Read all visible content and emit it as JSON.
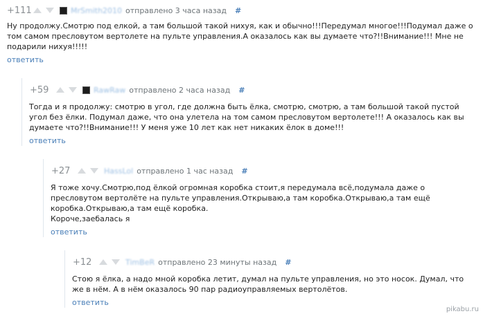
{
  "comments": [
    {
      "rating": "+111",
      "author": "MrSmith2010",
      "sent": "отправлено 3 часа назад",
      "hash": "#",
      "text": "Ну продолжу.Смотрю под елкой, а там большой такой нихуя, как и обычно!!!Передумал многое!!!Подумал даже о том самом пресловутом вертолете на пульте управления.А оказалось как вы думаете что?!!Внимание!!! Мне не подарили нихуя!!!!!",
      "reply": "ответить"
    },
    {
      "rating": "+59",
      "author": "RawRaw",
      "sent": "отправлено 2 часа назад",
      "hash": "#",
      "text": "Тогда и я продолжу: смотрю в угол, где должна быть ёлка, смотрю, смотрю, а там большой такой пустой угол без ёлки. Подумал даже, что она улетела на том самом пресловутом вертолете!!! А оказалось как вы думаете что?!!Внимание!!! У меня уже 10 лет как нет никаких ёлок в доме!!!",
      "reply": "ответить"
    },
    {
      "rating": "+27",
      "author": "HassLol",
      "sent": "отправлено 1 час назад",
      "hash": "#",
      "lines": [
        "Я тоже хочу.Смотрю,под ёлкой огромная коробка стоит,я передумала всё,подумала даже о пресловутом вертолёте на пульте управления.Открываю,а там коробка.Открываю,а там ещё коробка.Открываю,а там ещё коробка.",
        "Короче,заебалась я"
      ],
      "reply": "ответить"
    },
    {
      "rating": "+12",
      "author": "TimBeR",
      "sent": "отправлено 23 минуты назад",
      "hash": "#",
      "text": "Стою я ёлка, а надо мной коробка летит, думал на пульте управления, но это носок. Думал, что же в нём. А в нём оказалось 90 пар радиоуправляемых вертолётов.",
      "reply": "ответить"
    }
  ],
  "watermark": "pikabu.ru",
  "colors": {
    "link": "#4a7fb8",
    "author": "#9ec0e3",
    "meta": "#6d7478",
    "thread_line": "#dfe6ed"
  },
  "icons": {
    "vote_up": "triangle-up-icon",
    "vote_down": "triangle-down-icon",
    "avatar": "avatar-image"
  }
}
